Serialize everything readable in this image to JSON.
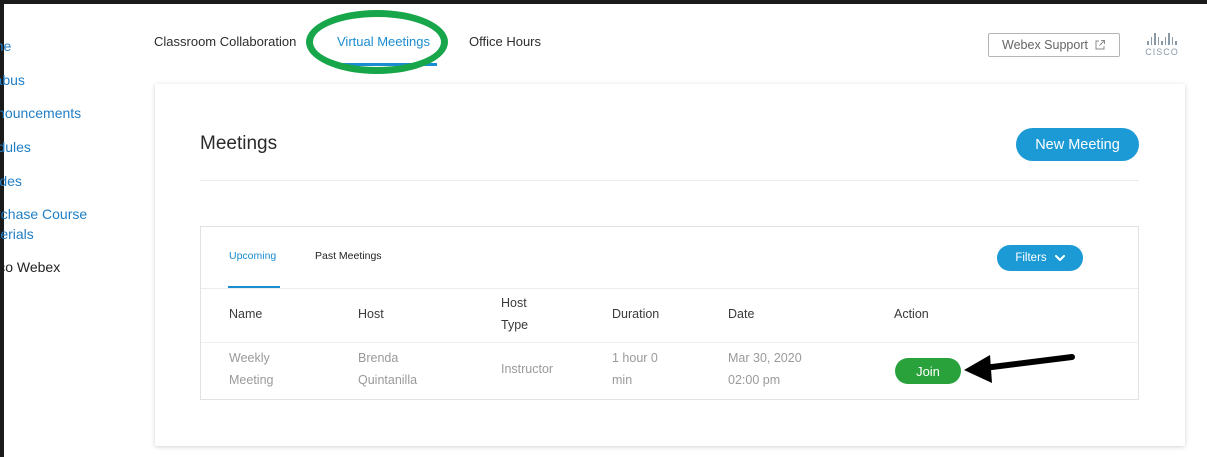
{
  "sidebar": {
    "items": [
      {
        "label": "Home"
      },
      {
        "label": "Syllabus"
      },
      {
        "label": "Announcements"
      },
      {
        "label": "Modules"
      },
      {
        "label": "Grades"
      },
      {
        "label": "Purchase Course"
      },
      {
        "label": "Materials"
      },
      {
        "label": "Cisco Webex"
      }
    ]
  },
  "topnav": {
    "tabs": [
      {
        "label": "Classroom Collaboration"
      },
      {
        "label": "Virtual Meetings"
      },
      {
        "label": "Office Hours"
      }
    ],
    "support_label": "Webex Support",
    "logo_text": "CISCO"
  },
  "main": {
    "title": "Meetings",
    "new_meeting_label": "New Meeting",
    "tabs": [
      {
        "label": "Upcoming"
      },
      {
        "label": "Past Meetings"
      }
    ],
    "filters_label": "Filters",
    "table": {
      "headers": {
        "name": "Name",
        "host": "Host",
        "host_type_1": "Host",
        "host_type_2": "Type",
        "duration": "Duration",
        "date": "Date",
        "action": "Action"
      },
      "rows": [
        {
          "name_1": "Weekly",
          "name_2": "Meeting",
          "host_1": "Brenda",
          "host_2": "Quintanilla",
          "host_type": "Instructor",
          "duration_1": "1 hour 0",
          "duration_2": "min",
          "date_1": "Mar 30, 2020",
          "date_2": "02:00 pm",
          "action_label": "Join"
        }
      ]
    }
  },
  "colors": {
    "accent": "#1c9ad6",
    "join": "#2aa23c",
    "highlight_oval": "#17a64a"
  }
}
